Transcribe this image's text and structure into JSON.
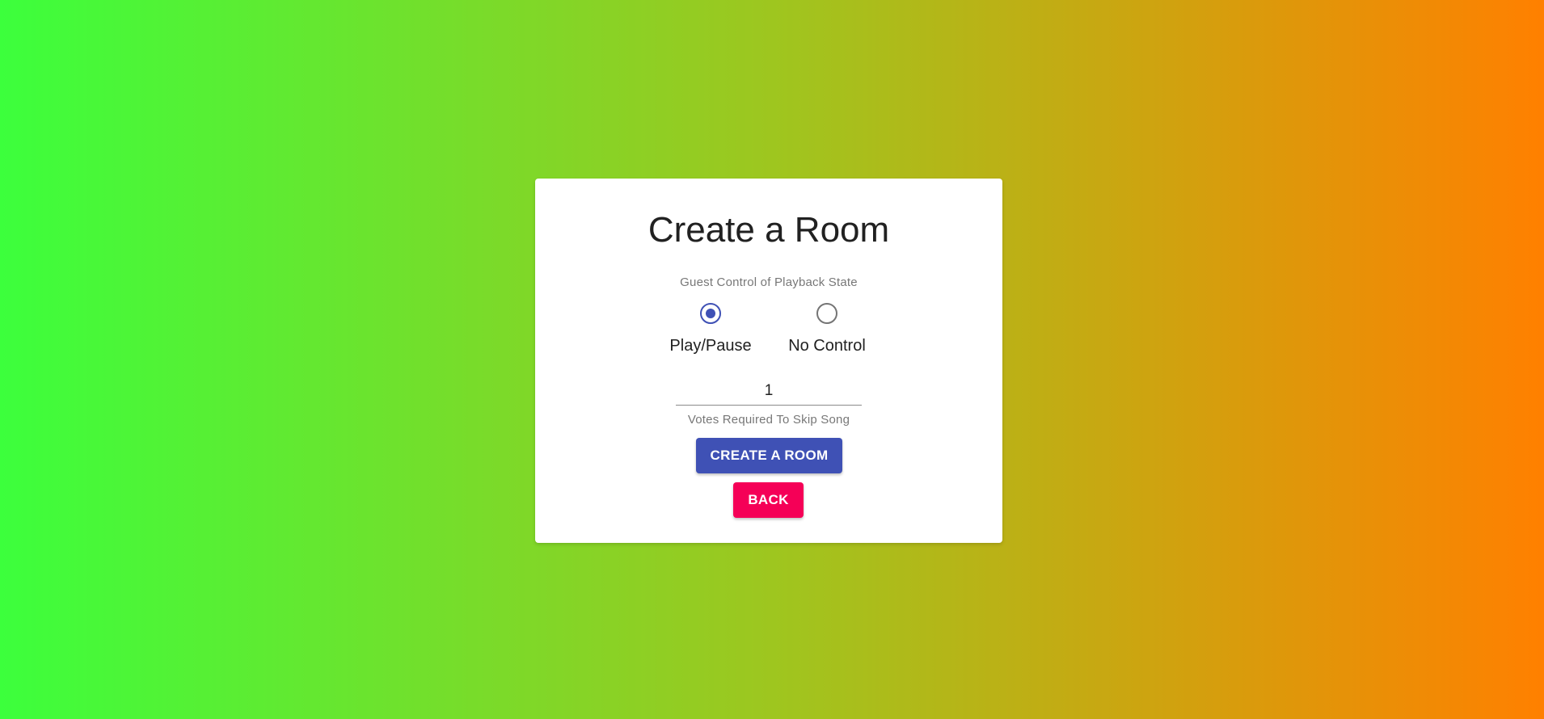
{
  "form": {
    "title": "Create a Room",
    "playback_legend": "Guest Control of Playback State",
    "radio_options": [
      {
        "label": "Play/Pause",
        "checked": true
      },
      {
        "label": "No Control",
        "checked": false
      }
    ],
    "votes_value": "1",
    "votes_helper": "Votes Required To Skip Song",
    "create_label": "CREATE A ROOM",
    "back_label": "BACK"
  },
  "colors": {
    "primary": "#3f51b5",
    "secondary": "#f50057",
    "gradient_start": "#3cff3c",
    "gradient_end": "#ff8000"
  }
}
